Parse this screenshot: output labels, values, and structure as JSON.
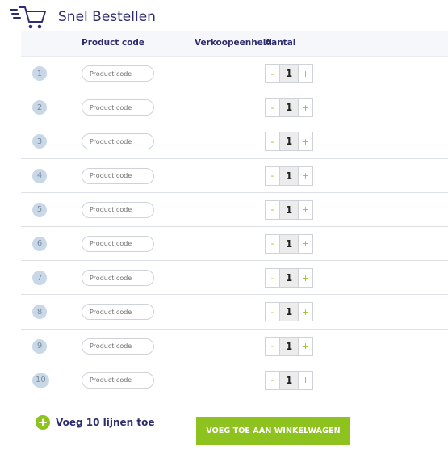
{
  "header": {
    "icon": "shopping-cart-icon",
    "title": "Snel Bestellen"
  },
  "table": {
    "columns": {
      "product_code": "Product code",
      "unit": "Verkoopeenheid",
      "quantity": "Aantal"
    },
    "rows": [
      {
        "number": "1",
        "placeholder": "Product code",
        "quantity": "1",
        "minus": "-",
        "plus": "+"
      },
      {
        "number": "2",
        "placeholder": "Product code",
        "quantity": "1",
        "minus": "-",
        "plus": "+"
      },
      {
        "number": "3",
        "placeholder": "Product code",
        "quantity": "1",
        "minus": "-",
        "plus": "+"
      },
      {
        "number": "4",
        "placeholder": "Product code",
        "quantity": "1",
        "minus": "-",
        "plus": "+"
      },
      {
        "number": "5",
        "placeholder": "Product code",
        "quantity": "1",
        "minus": "-",
        "plus": "+"
      },
      {
        "number": "6",
        "placeholder": "Product code",
        "quantity": "1",
        "minus": "-",
        "plus": "+"
      },
      {
        "number": "7",
        "placeholder": "Product code",
        "quantity": "1",
        "minus": "-",
        "plus": "+"
      },
      {
        "number": "8",
        "placeholder": "Product code",
        "quantity": "1",
        "minus": "-",
        "plus": "+"
      },
      {
        "number": "9",
        "placeholder": "Product code",
        "quantity": "1",
        "minus": "-",
        "plus": "+"
      },
      {
        "number": "10",
        "placeholder": "Product code",
        "quantity": "1",
        "minus": "-",
        "plus": "+"
      }
    ]
  },
  "footer": {
    "add_lines_icon": "plus-circle-icon",
    "add_lines_label": "Voeg 10 lijnen toe",
    "cart_button_label": "VOEG TOE AAN WINKELWAGEN"
  },
  "colors": {
    "brand_navy": "#2d2c6e",
    "accent_green": "#8dc21f",
    "row_number_badge": "#c9d8e6",
    "header_row_bg": "#f5f7fa"
  }
}
